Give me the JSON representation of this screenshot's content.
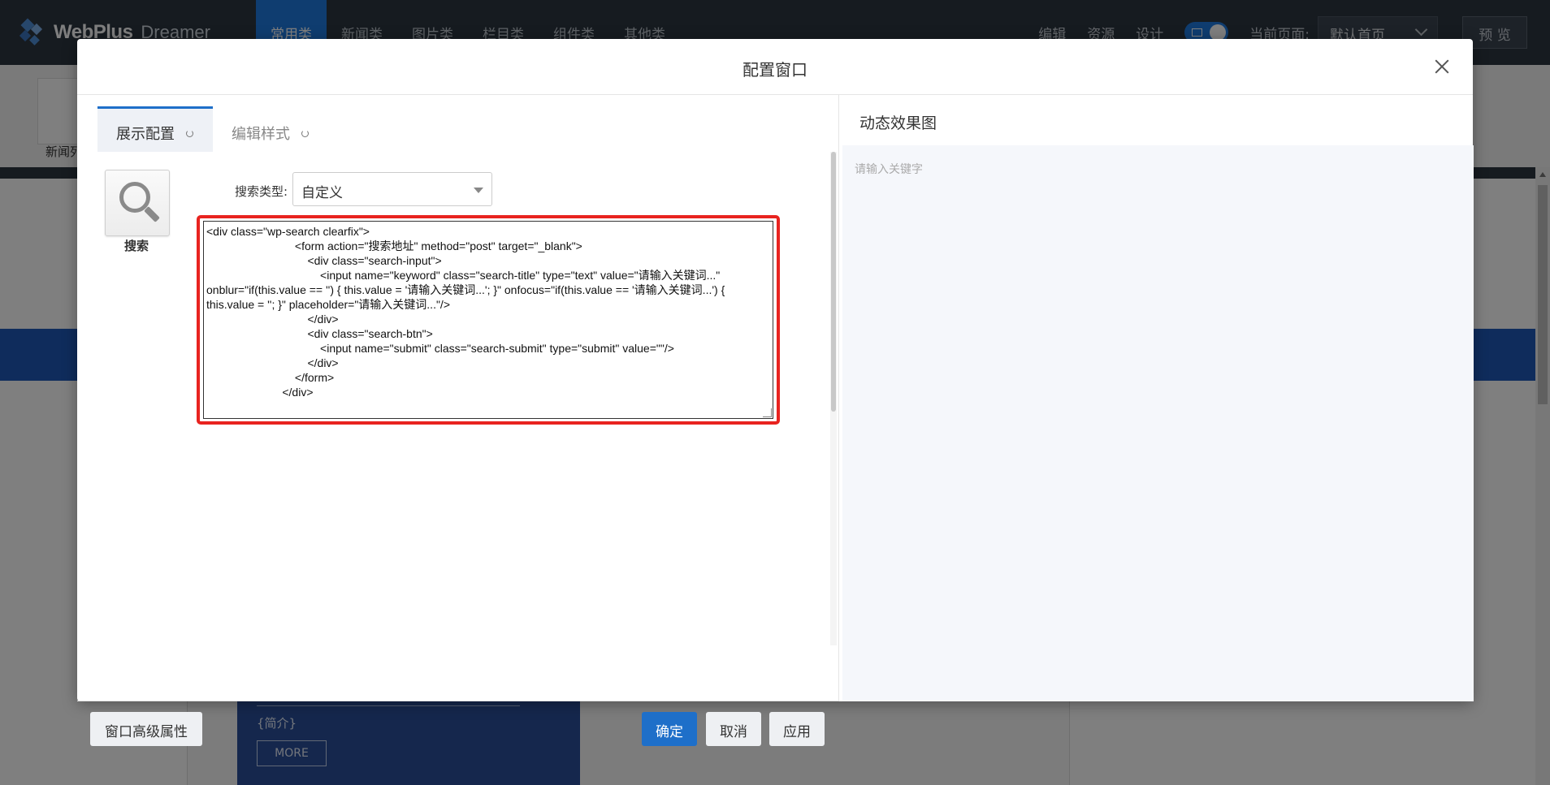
{
  "app": {
    "logo_brand": "WebPlus",
    "logo_sub": "Dreamer",
    "nav_tabs": [
      "常用类",
      "新闻类",
      "图片类",
      "栏目类",
      "组件类",
      "其他类"
    ],
    "tools": [
      "编辑",
      "资源",
      "设计"
    ],
    "current_page_label": "当前页面:",
    "current_page_value": "默认首页",
    "preview_label": "预 览",
    "news_widget_label": "新闻列",
    "content": {
      "intro": "{简介}",
      "more": "MORE"
    }
  },
  "modal": {
    "title": "配置窗口",
    "tabs": [
      {
        "label": "展示配置",
        "active": true
      },
      {
        "label": "编辑样式",
        "active": false
      }
    ],
    "widget_label": "搜索",
    "search_type_label": "搜索类型:",
    "search_type_value": "自定义",
    "code": "<div class=\"wp-search clearfix\">\n\t\t\t\t\t\t\t<form action=\"搜索地址\" method=\"post\" target=\"_blank\">\n\t\t\t\t\t\t\t\t<div class=\"search-input\">\n\t\t\t\t\t\t\t\t\t<input name=\"keyword\" class=\"search-title\" type=\"text\" value=\"请输入关键词...\" onblur=\"if(this.value == '') { this.value = '请输入关键词...'; }\" onfocus=\"if(this.value == '请输入关键词...') { this.value = ''; }\" placeholder=\"请输入关键词...\"/>\n\t\t\t\t\t\t\t\t</div>\n\t\t\t\t\t\t\t\t<div class=\"search-btn\">\n\t\t\t\t\t\t\t\t\t<input name=\"submit\" class=\"search-submit\" type=\"submit\" value=\"\"/>\n\t\t\t\t\t\t\t\t</div>\n\t\t\t\t\t\t\t</form>\n\t\t\t\t\t\t</div>",
    "footer": {
      "advanced_label": "窗口高级属性",
      "ok_label": "确定",
      "cancel_label": "取消",
      "apply_label": "应用"
    },
    "preview": {
      "title": "动态效果图",
      "placeholder": "请输入关键字"
    }
  },
  "colors": {
    "accent": "#1e6fc9",
    "highlight_border": "#e8231f",
    "topbar": "#2d3640"
  }
}
